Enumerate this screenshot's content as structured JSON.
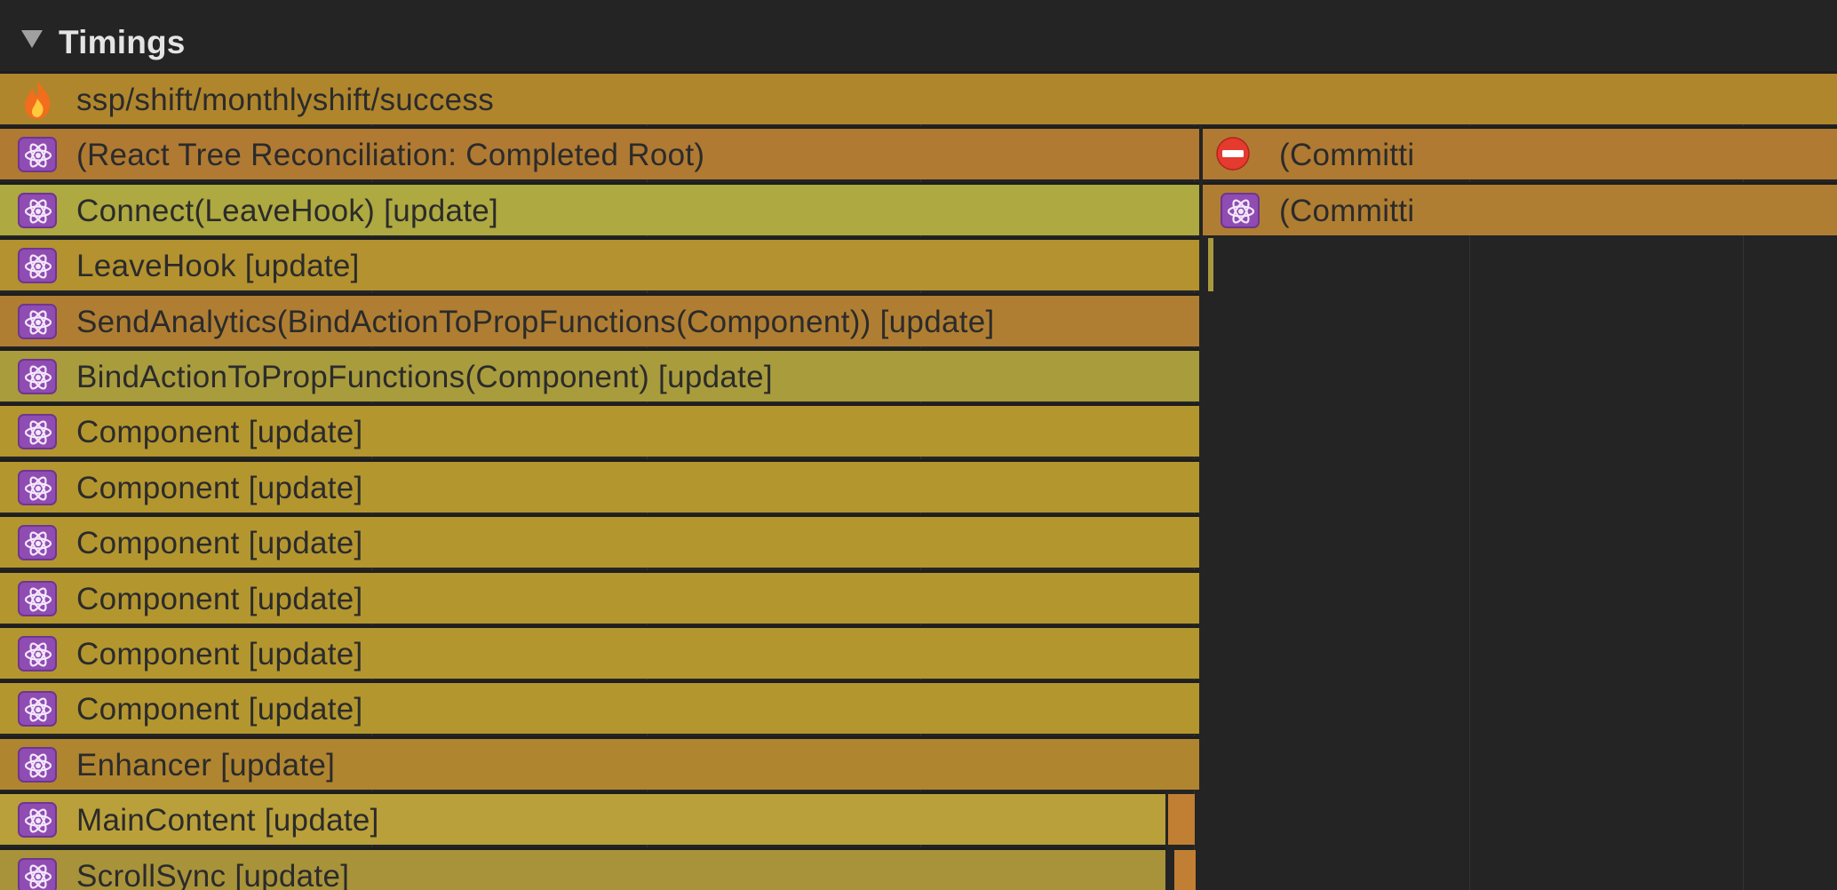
{
  "section": {
    "title": "Timings",
    "toggle_icon": "disclosure-triangle-down-icon"
  },
  "colors": {
    "background": "#242424",
    "row_separator": "#1e1e1e",
    "react_icon_bg": "#8f4cb2",
    "label_text": "#2b2b2b"
  },
  "rows": [
    {
      "label": "ssp/shift/monthlyshift/success",
      "icon": "fire-icon",
      "color": "#b0862c"
    },
    {
      "label": "(React Tree Reconciliation: Completed Root)",
      "icon": "react-icon",
      "color": "#b07a32"
    },
    {
      "label": "Connect(LeaveHook) [update]",
      "icon": "react-icon",
      "color": "#aea940"
    },
    {
      "label": "LeaveHook [update]",
      "icon": "react-icon",
      "color": "#b3922f"
    },
    {
      "label": "SendAnalytics(BindActionToPropFunctions(Component)) [update]",
      "icon": "react-icon",
      "color": "#b07e32"
    },
    {
      "label": "BindActionToPropFunctions(Component) [update]",
      "icon": "react-icon",
      "color": "#a99c3d"
    },
    {
      "label": "Component [update]",
      "icon": "react-icon",
      "color": "#b4962f"
    },
    {
      "label": "Component [update]",
      "icon": "react-icon",
      "color": "#b4962f"
    },
    {
      "label": "Component [update]",
      "icon": "react-icon",
      "color": "#b4962f"
    },
    {
      "label": "Component [update]",
      "icon": "react-icon",
      "color": "#b4962f"
    },
    {
      "label": "Component [update]",
      "icon": "react-icon",
      "color": "#b4962f"
    },
    {
      "label": "Component [update]",
      "icon": "react-icon",
      "color": "#b4962f"
    },
    {
      "label": "Enhancer [update]",
      "icon": "react-icon",
      "color": "#b08530"
    },
    {
      "label": "MainContent [update]",
      "icon": "react-icon",
      "color": "#b9a03a"
    },
    {
      "label": "ScrollSync [update]",
      "icon": "react-icon",
      "color": "#a8933b"
    }
  ],
  "right_rows": [
    {
      "label": "(Committi",
      "icon": "stop-sign-icon",
      "color": "#b07a32"
    },
    {
      "label": "(Committi",
      "icon": "react-icon",
      "color": "#b07e32"
    }
  ],
  "small_marks": [
    {
      "name": "leavehook-followup-bar",
      "color": "#a89a3c"
    },
    {
      "name": "maincontent-tail-bar",
      "color": "#c17f33"
    },
    {
      "name": "scrollsync-tail-bar",
      "color": "#c17f33"
    }
  ]
}
